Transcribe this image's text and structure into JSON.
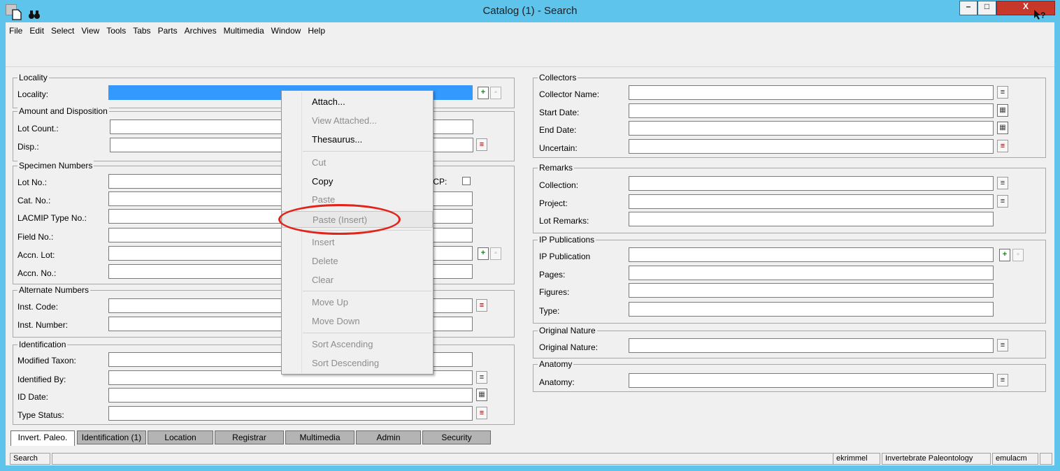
{
  "window": {
    "title": "Catalog (1) - Search",
    "min_glyph": "–",
    "max_glyph": "□",
    "close_glyph": "X"
  },
  "menu": [
    "File",
    "Edit",
    "Select",
    "View",
    "Tools",
    "Tabs",
    "Parts",
    "Archives",
    "Multimedia",
    "Window",
    "Help"
  ],
  "toolbar": {
    "new_icon": "🗋",
    "find_icon": "🔭",
    "help_icon": "↖?"
  },
  "sections": {
    "locality": {
      "title": "Locality",
      "fields": {
        "locality": "Locality:"
      }
    },
    "amount": {
      "title": "Amount and Disposition",
      "fields": {
        "lot_count": "Lot Count.:",
        "disp": "Disp.:"
      }
    },
    "specimen": {
      "title": "Specimen Numbers",
      "fields": {
        "lot_no": "Lot No.:",
        "cat_no": "Cat. No.:",
        "lacmip": "LACMIP Type No.:",
        "field_no": "Field No.:",
        "accn_lot": "Accn. Lot:",
        "accn_no": "Accn. No.:"
      },
      "check_label": "P/CP:"
    },
    "alternate": {
      "title": "Alternate Numbers",
      "fields": {
        "inst_code": "Inst. Code:",
        "inst_number": "Inst. Number:"
      }
    },
    "identification": {
      "title": "Identification",
      "fields": {
        "modified_taxon": "Modified Taxon:",
        "identified_by": "Identified By:",
        "id_date": "ID Date:",
        "type_status": "Type Status:"
      }
    },
    "collectors": {
      "title": "Collectors",
      "fields": {
        "collector_name": "Collector Name:",
        "start_date": "Start Date:",
        "end_date": "End Date:",
        "uncertain": "Uncertain:"
      }
    },
    "remarks": {
      "title": "Remarks",
      "fields": {
        "collection": "Collection:",
        "project": "Project:",
        "lot_remarks": "Lot Remarks:"
      }
    },
    "ip_publications": {
      "title": "IP Publications",
      "fields": {
        "ip_publication": "IP Publication",
        "pages": "Pages:",
        "figures": "Figures:",
        "type": "Type:"
      }
    },
    "original_nature": {
      "title": "Original Nature",
      "fields": {
        "original_nature": "Original Nature:"
      }
    },
    "anatomy": {
      "title": "Anatomy",
      "fields": {
        "anatomy": "Anatomy:"
      }
    }
  },
  "icons": {
    "lookup": "≡",
    "calendar": "▦",
    "attach_green": "+",
    "attach_grey": "▫"
  },
  "context_menu": {
    "attach": "Attach...",
    "view_attached": "View Attached...",
    "thesaurus": "Thesaurus...",
    "cut": "Cut",
    "copy": "Copy",
    "paste": "Paste",
    "paste_insert": "Paste (Insert)",
    "insert": "Insert",
    "delete": "Delete",
    "clear": "Clear",
    "move_up": "Move Up",
    "move_down": "Move Down",
    "sort_ascending": "Sort Ascending",
    "sort_descending": "Sort Descending"
  },
  "tabs": [
    "Invert. Paleo.",
    "Identification (1)",
    "Location",
    "Registrar",
    "Multimedia",
    "Admin",
    "Security"
  ],
  "status": {
    "mode": "Search",
    "user": "ekrimmel",
    "department": "Invertebrate Paleontology",
    "database": "emulacm"
  }
}
